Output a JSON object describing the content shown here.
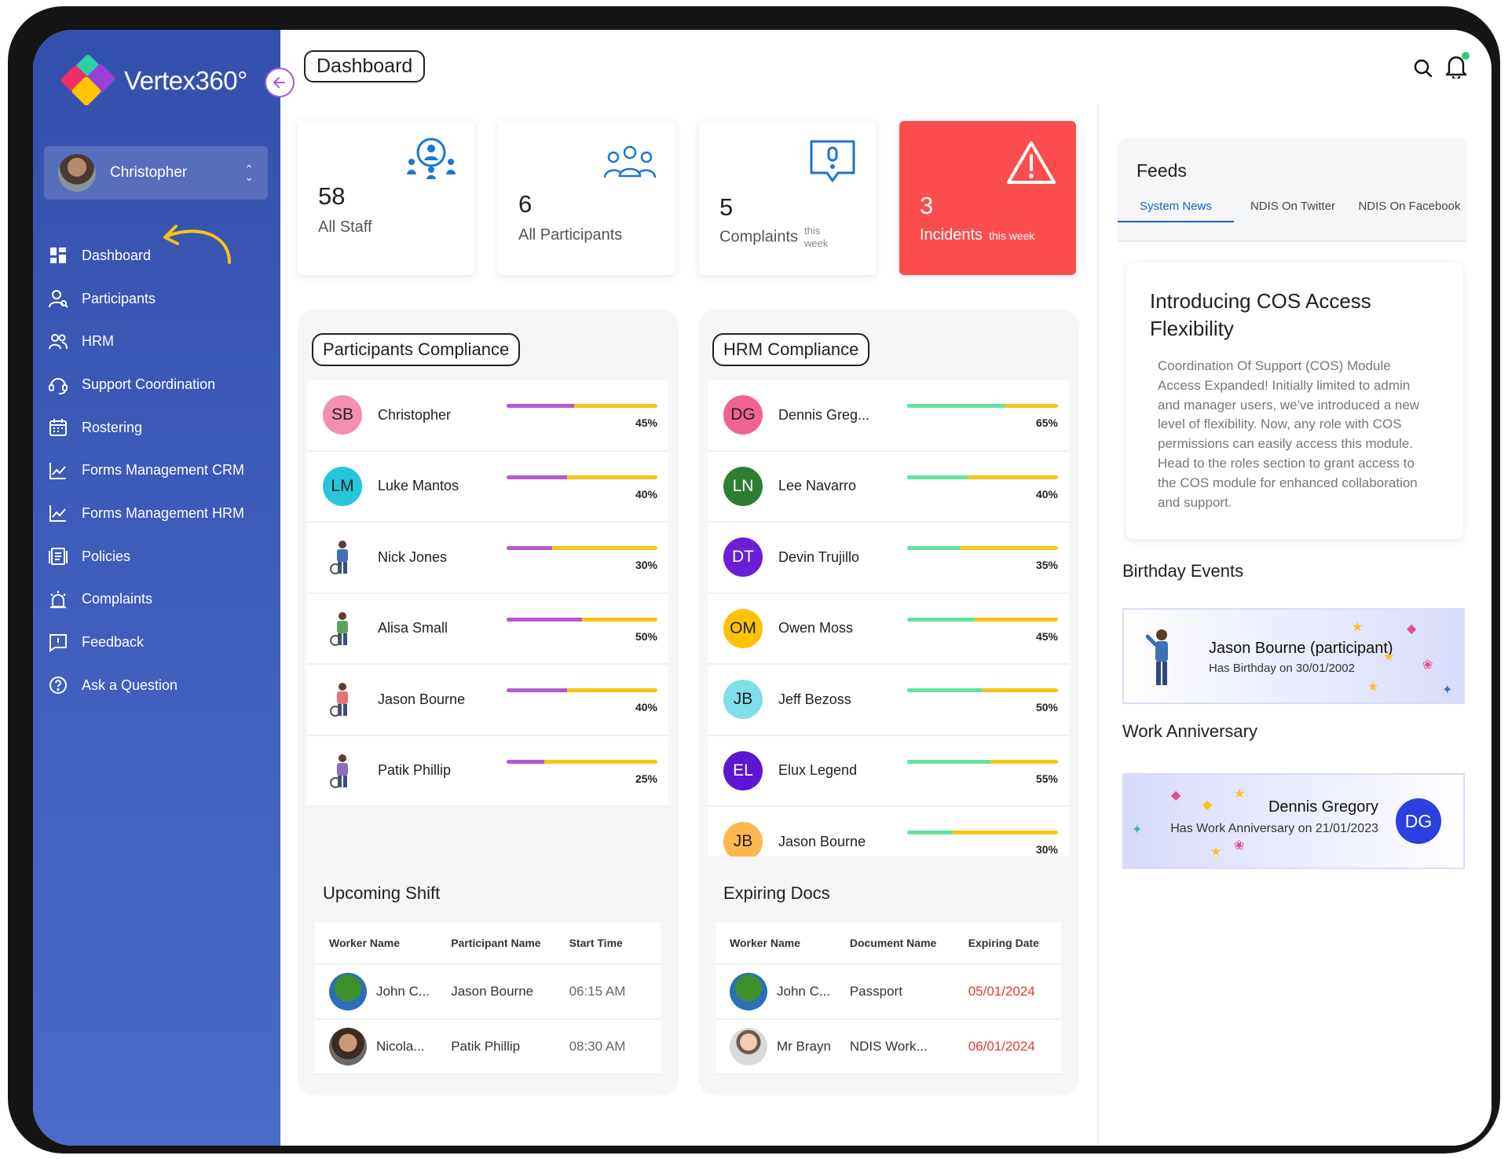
{
  "app": {
    "name": "Vertex360°"
  },
  "user": {
    "name": "Christopher"
  },
  "nav": [
    {
      "label": "Dashboard",
      "icon": "dashboard-icon"
    },
    {
      "label": "Participants",
      "icon": "participants-icon"
    },
    {
      "label": "HRM",
      "icon": "hrm-icon"
    },
    {
      "label": "Support Coordination",
      "icon": "headset-icon"
    },
    {
      "label": "Rostering",
      "icon": "calendar-icon"
    },
    {
      "label": "Forms Management CRM",
      "icon": "chart-icon"
    },
    {
      "label": "Forms Management HRM",
      "icon": "chart-icon"
    },
    {
      "label": "Policies",
      "icon": "document-icon"
    },
    {
      "label": "Complaints",
      "icon": "alarm-icon"
    },
    {
      "label": "Feedback",
      "icon": "feedback-icon"
    },
    {
      "label": "Ask a Question",
      "icon": "question-icon"
    }
  ],
  "page_title": "Dashboard",
  "stats": [
    {
      "value": "58",
      "label": "All Staff",
      "sub": ""
    },
    {
      "value": "6",
      "label": "All Participants",
      "sub": ""
    },
    {
      "value": "5",
      "label": "Complaints",
      "sub": "this week"
    },
    {
      "value": "3",
      "label": "Incidents",
      "sub": "this week"
    }
  ],
  "participants_compliance": {
    "title": "Participants Compliance",
    "rows": [
      {
        "initials": "SB",
        "name": "Christopher",
        "pct": "45%",
        "value": 0.45
      },
      {
        "initials": "LM",
        "name": "Luke Mantos",
        "pct": "40%",
        "value": 0.4
      },
      {
        "initials": "",
        "name": "Nick Jones",
        "pct": "30%",
        "value": 0.3
      },
      {
        "initials": "",
        "name": "Alisa Small",
        "pct": "50%",
        "value": 0.5
      },
      {
        "initials": "",
        "name": "Jason Bourne",
        "pct": "40%",
        "value": 0.4
      },
      {
        "initials": "",
        "name": "Patik Phillip",
        "pct": "25%",
        "value": 0.25
      }
    ]
  },
  "hrm_compliance": {
    "title": "HRM Compliance",
    "rows": [
      {
        "initials": "DG",
        "name": "Dennis Greg...",
        "pct": "65%",
        "value": 0.65
      },
      {
        "initials": "LN",
        "name": "Lee Navarro",
        "pct": "40%",
        "value": 0.4
      },
      {
        "initials": "DT",
        "name": "Devin Trujillo",
        "pct": "35%",
        "value": 0.35
      },
      {
        "initials": "OM",
        "name": "Owen Moss",
        "pct": "45%",
        "value": 0.45
      },
      {
        "initials": "JB",
        "name": "Jeff Bezoss",
        "pct": "50%",
        "value": 0.5
      },
      {
        "initials": "EL",
        "name": "Elux Legend",
        "pct": "55%",
        "value": 0.55
      },
      {
        "initials": "JB",
        "name": "Jason Bourne",
        "pct": "30%",
        "value": 0.3
      }
    ]
  },
  "upcoming_shift": {
    "title": "Upcoming Shift",
    "headers": [
      "Worker Name",
      "Participant Name",
      "Start Time"
    ],
    "rows": [
      [
        "John C...",
        "Jason Bourne",
        "06:15 AM"
      ],
      [
        "Nicola...",
        "Patik Phillip",
        "08:30 AM"
      ]
    ]
  },
  "expiring_docs": {
    "title": "Expiring Docs",
    "headers": [
      "Worker Name",
      "Document Name",
      "Expiring Date"
    ],
    "rows": [
      [
        "John C...",
        "Passport",
        "05/01/2024"
      ],
      [
        "Mr Brayn",
        "NDIS Work...",
        "06/01/2024"
      ]
    ]
  },
  "feeds": {
    "title": "Feeds",
    "tabs": [
      "System News",
      "NDIS On Twitter",
      "NDIS On Facebook"
    ],
    "news_title": "Introducing COS Access Flexibility",
    "news_body": "Coordination Of Support (COS) Module Access Expanded! Initially limited to admin and manager users, we've introduced a new level of flexibility. Now, any role with COS permissions can easily access this module. Head to the roles section to grant access to the COS module for enhanced collaboration and support."
  },
  "birthday": {
    "title": "Birthday Events",
    "name": "Jason Bourne (participant)",
    "sub": "Has Birthday on 30/01/2002"
  },
  "anniversary": {
    "title": "Work Anniversary",
    "name": "Dennis Gregory",
    "sub": "Has Work Anniversary on 21/01/2023",
    "initials": "DG"
  },
  "colors": {
    "sidebar": "#3450ad",
    "incident": "#fb4d4d",
    "participants_bar": "#b55ad0",
    "hrm_bar": "#62e3a0",
    "bar_track": "#f7c418",
    "link": "#1565c0"
  }
}
